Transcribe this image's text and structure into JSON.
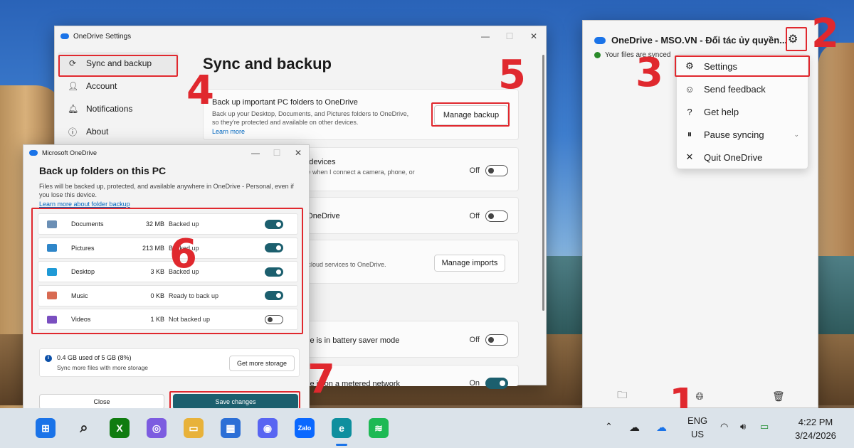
{
  "settings_window": {
    "title": "OneDrive Settings",
    "nav": [
      {
        "label": "Sync and backup",
        "icon": "sync-icon"
      },
      {
        "label": "Account",
        "icon": "person-icon"
      },
      {
        "label": "Notifications",
        "icon": "bell-icon"
      },
      {
        "label": "About",
        "icon": "info-icon"
      }
    ],
    "heading": "Sync and backup",
    "backup_card": {
      "title": "Back up important PC folders to OneDrive",
      "desc1": "Back up your Desktop, Documents, and Pictures folders to OneDrive,",
      "desc2": "so they're protected and available on other devices.",
      "link": "Learn more",
      "button": "Manage backup"
    },
    "devices_card": {
      "title": "m devices",
      "desc": "rive when I connect a camera, phone, or",
      "state": "Off"
    },
    "onedrive_card": {
      "title": "o OneDrive",
      "state": "Off"
    },
    "imports_card": {
      "title": "es",
      "desc": "er cloud services to OneDrive.",
      "button": "Manage imports"
    },
    "battery_card": {
      "title": "vice is in battery saver mode",
      "state": "Off"
    },
    "metered_card": {
      "title": "vice is on a metered network",
      "state": "On"
    }
  },
  "backup_dialog": {
    "title": "Microsoft OneDrive",
    "heading": "Back up folders on this PC",
    "paragraph": "Files will be backed up, protected, and available anywhere in OneDrive - Personal, even if you lose this device.",
    "link": "Learn more about folder backup",
    "folders": [
      {
        "name": "Documents",
        "size": "32 MB",
        "status": "Backed up",
        "on": true,
        "color": "#6b8fb5"
      },
      {
        "name": "Pictures",
        "size": "213 MB",
        "status": "Backed up",
        "on": true,
        "color": "#2e86c9"
      },
      {
        "name": "Desktop",
        "size": "3 KB",
        "status": "Backed up",
        "on": true,
        "color": "#1f9ad6"
      },
      {
        "name": "Music",
        "size": "0 KB",
        "status": "Ready to back up",
        "on": true,
        "color": "#d86a52"
      },
      {
        "name": "Videos",
        "size": "1 KB",
        "status": "Not backed up",
        "on": false,
        "color": "#7a4fc0"
      }
    ],
    "storage_used": "0.4 GB used of 5 GB (8%)",
    "storage_sub": "Sync more files with more storage",
    "get_storage": "Get more storage",
    "close": "Close",
    "save": "Save changes"
  },
  "flyout": {
    "title": "OneDrive - MSO.VN - Đối tác ủy quyền...",
    "status": "Your files are synced",
    "menu": [
      {
        "label": "Settings",
        "icon": "gear-icon"
      },
      {
        "label": "Send feedback",
        "icon": "feedback-icon"
      },
      {
        "label": "Get help",
        "icon": "help-icon"
      },
      {
        "label": "Pause syncing",
        "icon": "pause-icon"
      },
      {
        "label": "Quit OneDrive",
        "icon": "close-icon"
      }
    ]
  },
  "steps": [
    "1",
    "2",
    "3",
    "4",
    "5",
    "6",
    "7"
  ],
  "taskbar": {
    "lang1": "ENG",
    "lang2": "US",
    "time": "4:22 PM",
    "date": "3/24/2026"
  },
  "colors": {
    "highlight": "#e0282e",
    "toggle_on": "#1c5f6e",
    "save_button": "#1c5f6e"
  }
}
